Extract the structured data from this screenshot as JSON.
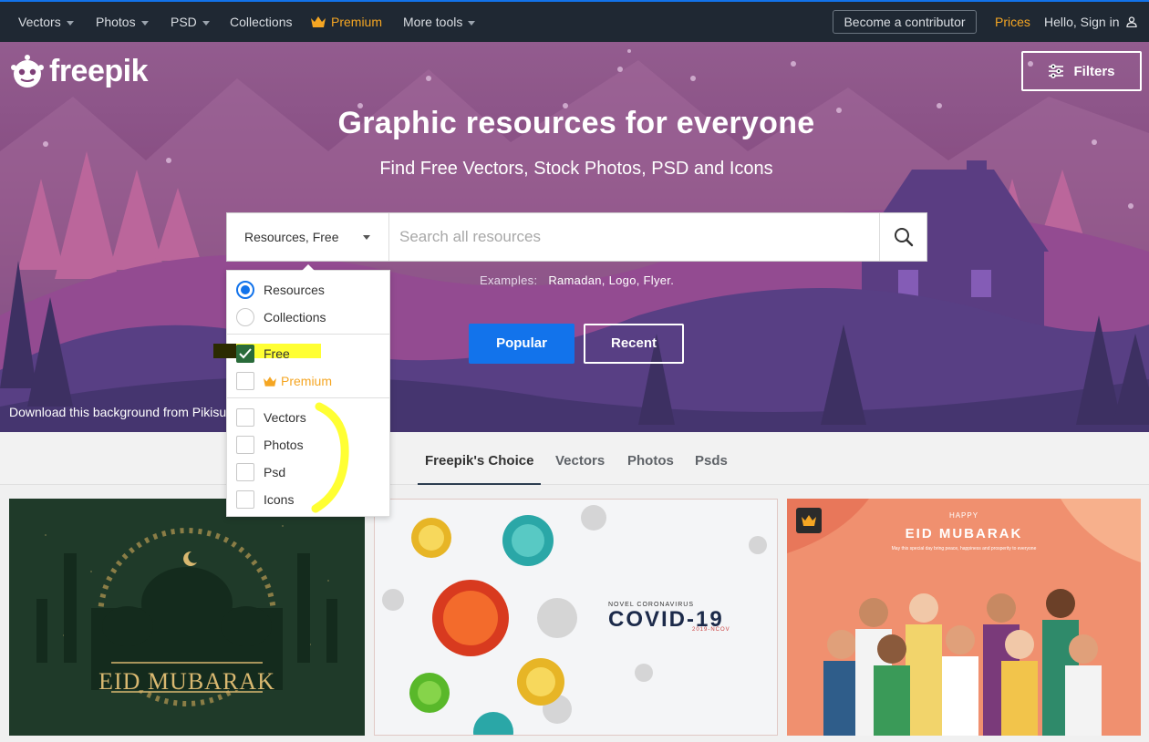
{
  "nav": {
    "vectors": "Vectors",
    "photos": "Photos",
    "psd": "PSD",
    "collections": "Collections",
    "premium": "Premium",
    "more_tools": "More tools",
    "become_contributor": "Become a contributor",
    "prices": "Prices",
    "sign_in": "Hello, Sign in"
  },
  "brand": {
    "logo_text": "freepik"
  },
  "hero": {
    "filters_label": "Filters",
    "title": "Graphic resources for everyone",
    "subtitle": "Find Free Vectors, Stock Photos, PSD and Icons",
    "resource_select": "Resources, Free",
    "search_placeholder": "Search all resources",
    "examples_label": "Examples:",
    "examples": "Ramadan, Logo, Flyer.",
    "popular": "Popular",
    "recent": "Recent",
    "background_credit": "Download this background from Pikisu"
  },
  "dropdown": {
    "scope_options": [
      {
        "label": "Resources",
        "selected": true
      },
      {
        "label": "Collections",
        "selected": false
      }
    ],
    "license_options": [
      {
        "label": "Free",
        "checked": true
      },
      {
        "label": "Premium",
        "checked": false
      }
    ],
    "type_options": [
      {
        "label": "Vectors",
        "checked": false
      },
      {
        "label": "Photos",
        "checked": false
      },
      {
        "label": "Psd",
        "checked": false
      },
      {
        "label": "Icons",
        "checked": false
      }
    ]
  },
  "tabs": [
    "Freepik's Choice",
    "Vectors",
    "Photos",
    "Psds"
  ],
  "gallery": {
    "card1_text": "EID MUBARAK",
    "card2_small": "NOVEL CORONAVIRUS",
    "card2_big": "COVID-19",
    "card2_tag": "2019-NCOV",
    "card3_happy": "HAPPY",
    "card3_title": "EID MUBARAK",
    "card3_sub": "May this special day bring peace, happiness and prosperity to everyone"
  },
  "colors": {
    "accent": "#1273eb",
    "premium": "#f5a623",
    "nav_bg": "#1f2833"
  }
}
